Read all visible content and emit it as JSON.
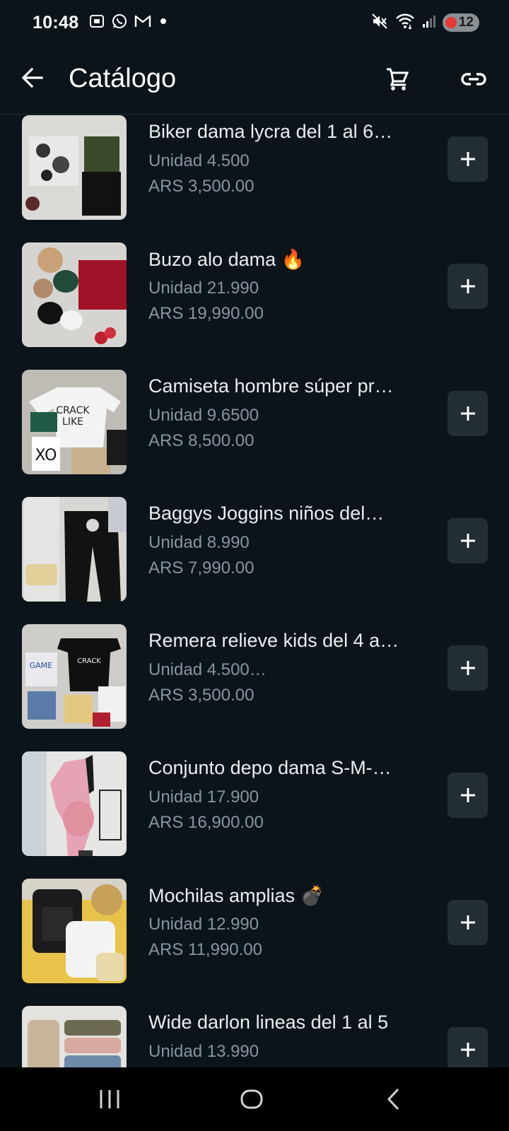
{
  "status_bar": {
    "time": "10:48",
    "left_icons": [
      "screenshot-icon",
      "whatsapp-icon",
      "gmail-icon",
      "dot-icon"
    ],
    "right_icons": [
      "mute-icon",
      "wifi-icon",
      "signal-icon"
    ],
    "battery_level": "12"
  },
  "app_bar": {
    "title": "Catálogo",
    "back_icon": "arrow-left-icon",
    "cart_icon": "cart-icon",
    "link_icon": "link-icon"
  },
  "products": [
    {
      "name": "Biker dama lycra del 1 al 6…",
      "unit": "Unidad 4.500",
      "price": "ARS 3,500.00"
    },
    {
      "name": "Buzo alo dama 🔥",
      "unit": "Unidad 21.990",
      "price": "ARS 19,990.00"
    },
    {
      "name": "Camiseta hombre súper pr…",
      "unit": "Unidad 9.6500",
      "price": "ARS 8,500.00"
    },
    {
      "name": "Baggys Joggins niños del…",
      "unit": "Unidad 8.990",
      "price": "ARS 7,990.00"
    },
    {
      "name": "Remera relieve kids del 4 a…",
      "unit": "Unidad 4.500…",
      "price": "ARS 3,500.00"
    },
    {
      "name": "Conjunto depo dama S-M-…",
      "unit": "Unidad 17.900",
      "price": "ARS 16,900.00"
    },
    {
      "name": "Mochilas amplias 💣",
      "unit": "Unidad 12.990",
      "price": "ARS 11,990.00"
    },
    {
      "name": "Wide darlon lineas del 1 al 5",
      "unit": "Unidad 13.990",
      "price": ""
    }
  ],
  "nav_bar": {
    "recents_icon": "recents-icon",
    "home_icon": "home-icon",
    "back_icon": "back-icon"
  },
  "colors": {
    "background": "#0b141a",
    "primary_text": "#e9edef",
    "secondary_text": "#8696a0",
    "button_bg": "#222d34"
  }
}
